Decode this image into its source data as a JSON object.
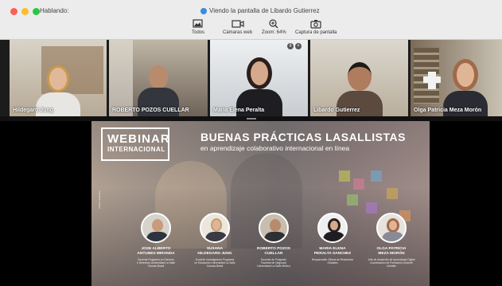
{
  "titlebar": {
    "speaking_label": "Hablando:",
    "viewing_label": "Viendo la pantalla de Libardo Gutierrez",
    "lights": {
      "close": "#ff5f57",
      "minimize": "#febc2e",
      "zoom": "#28c840"
    }
  },
  "toolbar": {
    "all_label": "Todos",
    "webcams_label": "Cámaras web",
    "zoom_label": "Zoom: 64%",
    "capture_label": "Captura de pantalla"
  },
  "participants": [
    {
      "name": "Hildegard Jung"
    },
    {
      "name": "ROBERTO POZOS CUELLAR"
    },
    {
      "name": "Maria Elena Peralta"
    },
    {
      "name": "Libardo Gutierrez"
    },
    {
      "name": "Olga Patricia Meza Morón"
    }
  ],
  "slide": {
    "webinar_line1": "WEBINAR",
    "webinar_line2": "INTERNACIONAL",
    "title": "BUENAS PRÁCTICAS LASALLISTAS",
    "subtitle": "en aprendizaje colaborativo internacional en línea",
    "vertical_text": "Diseño ilustrativo",
    "speakers": [
      {
        "name_l1": "JOSE ALBERTO",
        "name_l2": "ANTUNES MIRANDA",
        "desc_l1": "Docente Programa en Derecho",
        "desc_l2": "e Derechos Universidad La Salle",
        "desc_l3": "Canoas Brasil"
      },
      {
        "name_l1": "SUSANA",
        "name_l2": "HILDEGARD JUNG",
        "desc_l1": "Docente Investigadora Programa",
        "desc_l2": "en Educación Universidad La Salle",
        "desc_l3": "Canoas Brasil"
      },
      {
        "name_l1": "ROBERTO POZOS",
        "name_l2": "CUELLAR",
        "desc_l1": "Docente de Posgrado",
        "desc_l2": "Facultad de Negocios",
        "desc_l3": "Universidad La Salle México"
      },
      {
        "name_l1": "MARIA ELENA",
        "name_l2": "PERALTA SANCHEZ",
        "desc_l1": "Responsable Oficina de Relaciones",
        "desc_l2": "Globales",
        "desc_l3": ""
      },
      {
        "name_l1": "OLGA PATRICIA",
        "name_l2": "MEZA MORÓN",
        "desc_l1": "Jefe de desarrollo de Aprendizaje Digital",
        "desc_l2": "Coordinación de Formación Docente",
        "desc_l3": "Unisalle"
      }
    ]
  }
}
